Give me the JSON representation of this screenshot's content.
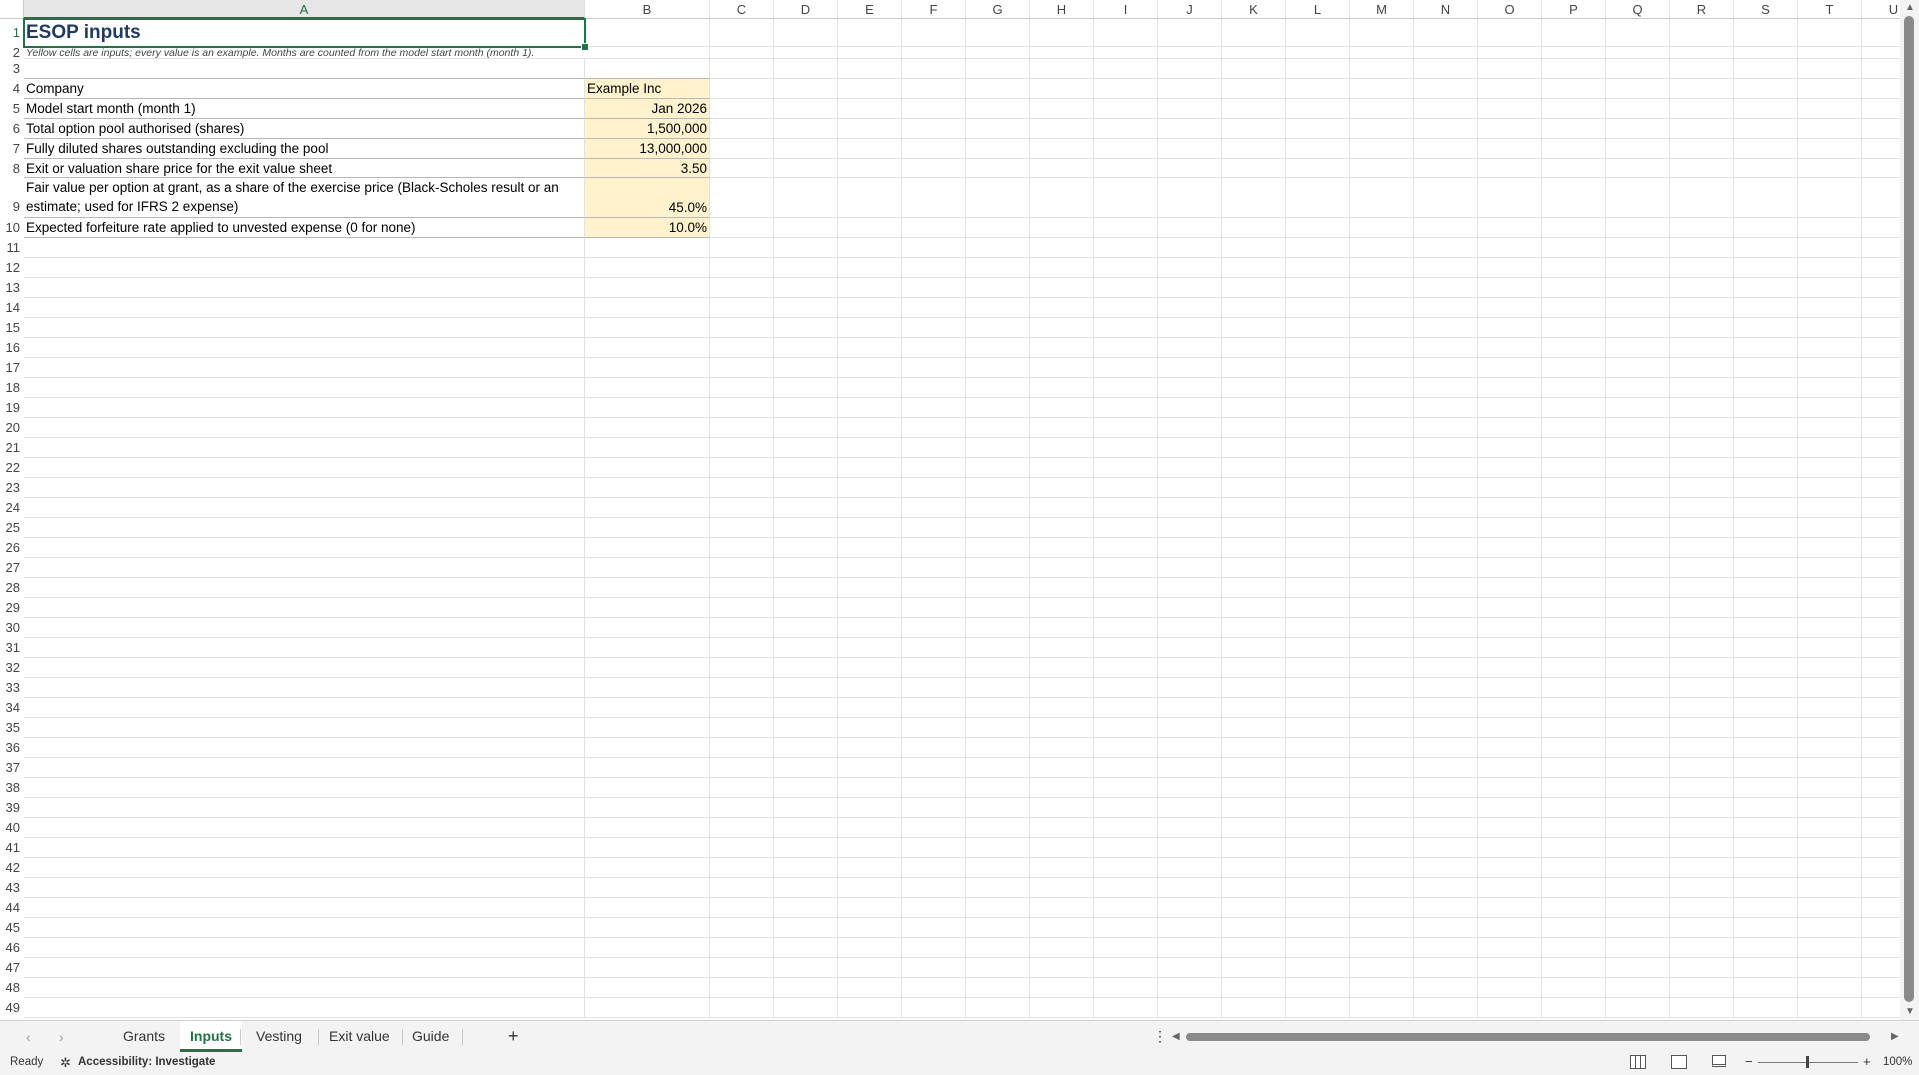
{
  "columns": [
    "A",
    "B",
    "C",
    "D",
    "E",
    "F",
    "G",
    "H",
    "I",
    "J",
    "K",
    "L",
    "M",
    "N",
    "O",
    "P",
    "Q",
    "R",
    "S",
    "T",
    "U"
  ],
  "rows": [
    "1",
    "2",
    "3",
    "4",
    "5",
    "6",
    "7",
    "8",
    "9",
    "10",
    "11",
    "12",
    "13",
    "14",
    "15",
    "16",
    "17",
    "18",
    "19",
    "20",
    "21",
    "22",
    "23",
    "24",
    "25",
    "26",
    "27",
    "28",
    "29",
    "30",
    "31",
    "32",
    "33",
    "34",
    "35",
    "36",
    "37",
    "38",
    "39",
    "40",
    "41",
    "42",
    "43",
    "44",
    "45",
    "46",
    "47",
    "48",
    "49"
  ],
  "sheet": {
    "title": "ESOP inputs",
    "note": "Yellow cells are inputs; every value is an example. Months are counted from the model start month (month 1).",
    "items": [
      {
        "label": "Company",
        "value": "Example Inc"
      },
      {
        "label": "Model start month (month 1)",
        "value": "Jan 2026"
      },
      {
        "label": "Total option pool authorised (shares)",
        "value": "1,500,000"
      },
      {
        "label": "Fully diluted shares outstanding excluding the pool",
        "value": "13,000,000"
      },
      {
        "label": "Exit or valuation share price for the exit value sheet",
        "value": "3.50"
      },
      {
        "label": "Fair value per option at grant, as a share of the exercise price (Black-Scholes result or an",
        "label2": "estimate; used for IFRS 2 expense)",
        "value": "45.0%"
      },
      {
        "label": "Expected forfeiture rate applied to unvested expense (0 for none)",
        "value": "10.0%"
      }
    ]
  },
  "tabs": [
    "Grants",
    "Inputs",
    "Vesting",
    "Exit value",
    "Guide"
  ],
  "active_tab": "Inputs",
  "add_sheet": "+",
  "more_options": "⋮",
  "status": {
    "ready": "Ready",
    "accessibility": "Accessibility: Investigate",
    "zoom": "100%",
    "zoom_minus": "−",
    "zoom_plus": "+"
  },
  "colors": {
    "accent": "#217346",
    "input_fill": "#fff2cc",
    "title": "#1f3b63"
  },
  "icons": [
    "accessibility-icon",
    "normal-view-icon",
    "page-layout-icon",
    "page-break-icon",
    "scroll-left-icon",
    "scroll-right-icon"
  ]
}
